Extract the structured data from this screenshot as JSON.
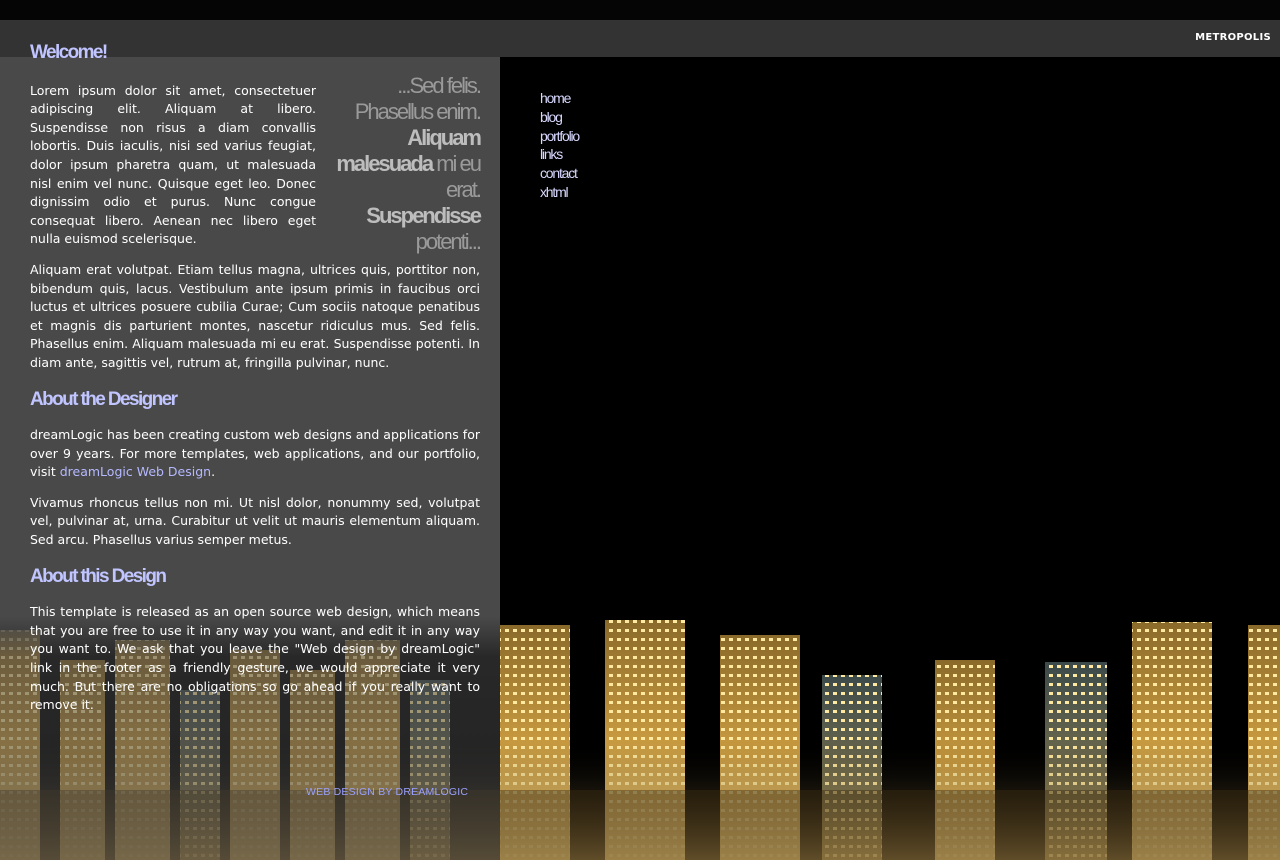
{
  "header": {
    "site_title": "METROPOLIS"
  },
  "nav": {
    "items": [
      {
        "label": "home"
      },
      {
        "label": "blog"
      },
      {
        "label": "portfolio"
      },
      {
        "label": "links"
      },
      {
        "label": "contact"
      },
      {
        "label": "xhtml"
      }
    ]
  },
  "main": {
    "welcome_heading": "Welcome!",
    "pullquote": {
      "line1": "...Sed felis.",
      "line2": "Phasellus enim.",
      "bold1": "Aliquam",
      "bold2": "malesuada",
      "line3_rest": " mi eu",
      "line4": "erat.",
      "bold3": "Suspendisse",
      "line5": "potenti..."
    },
    "welcome_p1": "Lorem ipsum dolor sit amet, consectetuer adipiscing elit. Aliquam at libero. Suspendisse non risus a diam convallis lobortis. Duis iaculis, nisi sed varius feugiat, dolor ipsum pharetra quam, ut malesuada nisl enim vel nunc. Quisque eget leo. Donec dignissim odio et purus. Nunc congue consequat libero. Aenean nec libero eget nulla euismod scelerisque.",
    "welcome_p2": "Aliquam erat volutpat. Etiam tellus magna, ultrices quis, porttitor non, bibendum quis, lacus. Vestibulum ante ipsum primis in faucibus orci luctus et ultrices posuere cubilia Curae; Cum sociis natoque penatibus et magnis dis parturient montes, nascetur ridiculus mus. Sed felis. Phasellus enim. Aliquam malesuada mi eu erat. Suspendisse potenti. In diam ante, sagittis vel, rutrum at, fringilla pulvinar, nunc.",
    "designer_heading": "About the Designer",
    "designer_p1_before": "dreamLogic has been creating custom web designs and applications for over 9 years. For more templates, web applications, and our portfolio, visit ",
    "designer_link": "dreamLogic Web Design",
    "designer_p1_after": ".",
    "designer_p2": "Vivamus rhoncus tellus non mi. Ut nisl dolor, nonummy sed, volutpat vel, pulvinar at, urna. Curabitur ut velit ut mauris elementum aliquam. Sed arcu. Phasellus varius semper metus.",
    "design_heading": "About this Design",
    "design_p1": "This template is released as an open source web design, which means that you are free to use it in any way you want, and edit it in any way you want to. We ask that you leave the \"Web design by dreamLogic\" link in the footer as a friendly gesture, we would appreciate it very much. But there are no obligations so go ahead if you really want to remove it."
  },
  "footer": {
    "credit": "WEB DESIGN BY DREAMLOGIC"
  },
  "colors": {
    "heading": "#c0c4ff",
    "link": "#b5b9ff",
    "panel": "#494949",
    "header_bar": "#333333"
  }
}
